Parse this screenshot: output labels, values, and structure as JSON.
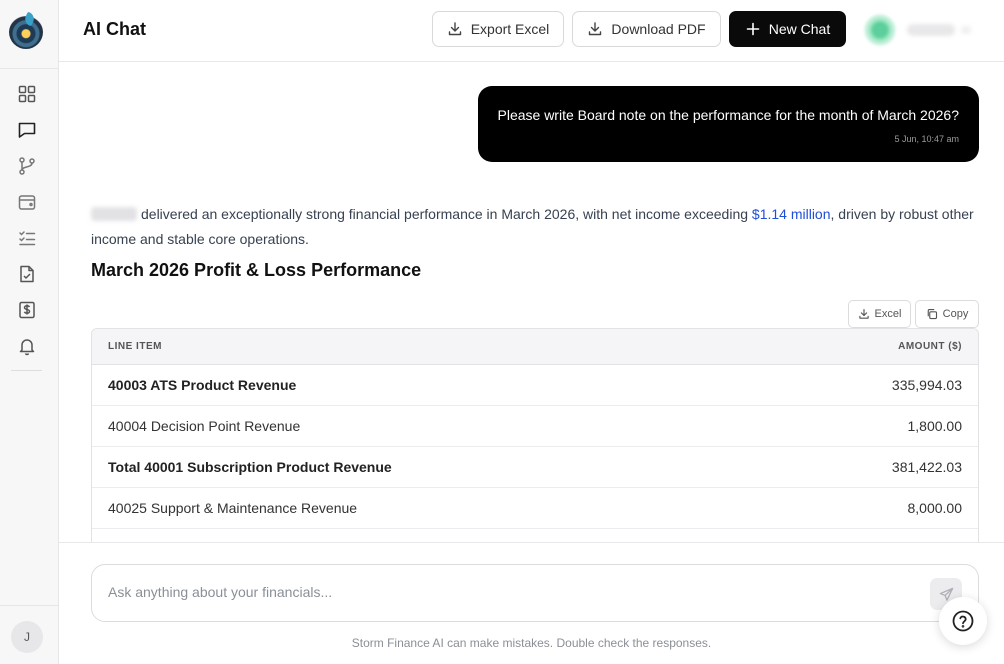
{
  "header": {
    "title": "AI Chat",
    "export_excel": "Export Excel",
    "download_pdf": "Download PDF",
    "new_chat": "New Chat"
  },
  "sidebar": {
    "icons": [
      "dashboard-icon",
      "chat-icon",
      "git-branch-icon",
      "wallet-icon",
      "checklist-icon",
      "file-check-icon",
      "dollar-document-icon",
      "bell-icon"
    ],
    "user_initial": "J"
  },
  "conversation": {
    "user_message": "Please write Board note on the performance for the month of March 2026?",
    "user_timestamp": "5 Jun, 10:47 am",
    "answer_intro_a": "delivered an exceptionally strong financial performance in March 2026, with net income exceeding ",
    "answer_highlight": "$1.14 million",
    "answer_intro_b": ", driven by robust other income and stable core operations.",
    "section_title": "March 2026 Profit & Loss Performance",
    "table_excel": "Excel",
    "table_copy": "Copy",
    "table": {
      "headers": [
        "LINE ITEM",
        "AMOUNT ($)"
      ],
      "rows": [
        {
          "item": "40003 ATS Product Revenue",
          "amount": "335,994.03",
          "bold": true
        },
        {
          "item": "40004 Decision Point Revenue",
          "amount": "1,800.00",
          "bold": false
        },
        {
          "item": "Total 40001 Subscription Product Revenue",
          "amount": "381,422.03",
          "bold": true
        },
        {
          "item": "40025 Support & Maintenance Revenue",
          "amount": "8,000.00",
          "bold": false
        },
        {
          "item": "",
          "amount": "",
          "bold": false
        }
      ]
    }
  },
  "composer": {
    "placeholder": "Ask anything about your financials...",
    "disclaimer": "Storm Finance AI can make mistakes. Double check the responses."
  }
}
